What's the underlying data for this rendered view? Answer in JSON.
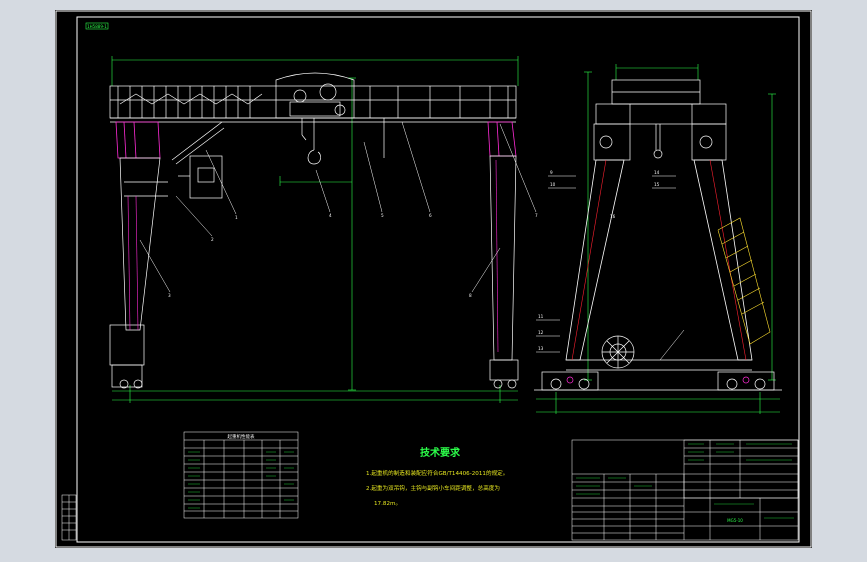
{
  "drawing": {
    "sheet_tag": "1H5889-1",
    "colors": {
      "background": "#000000",
      "frame": "#ffffff",
      "structure": "#ffffff",
      "legs": "#ff2bd6",
      "dimensions": "#2cff4a",
      "stair": "#ffe030",
      "tech_text": "#e8e820"
    }
  },
  "tech_requirements": {
    "title": "技术要求",
    "lines": [
      "1.起重机的制造和装配应符合GB/T14406-2011的规定。",
      "2.起重为双吊钩，主钩与副钩小车间距调整，总高度为",
      "17.82m。"
    ]
  },
  "callouts": [
    "1",
    "2",
    "3",
    "4",
    "5",
    "6",
    "7",
    "8",
    "9",
    "10",
    "11",
    "12",
    "13",
    "14",
    "15",
    "16"
  ],
  "parameter_table_title": "起重机性能表",
  "drawing_number": "MG5-10"
}
